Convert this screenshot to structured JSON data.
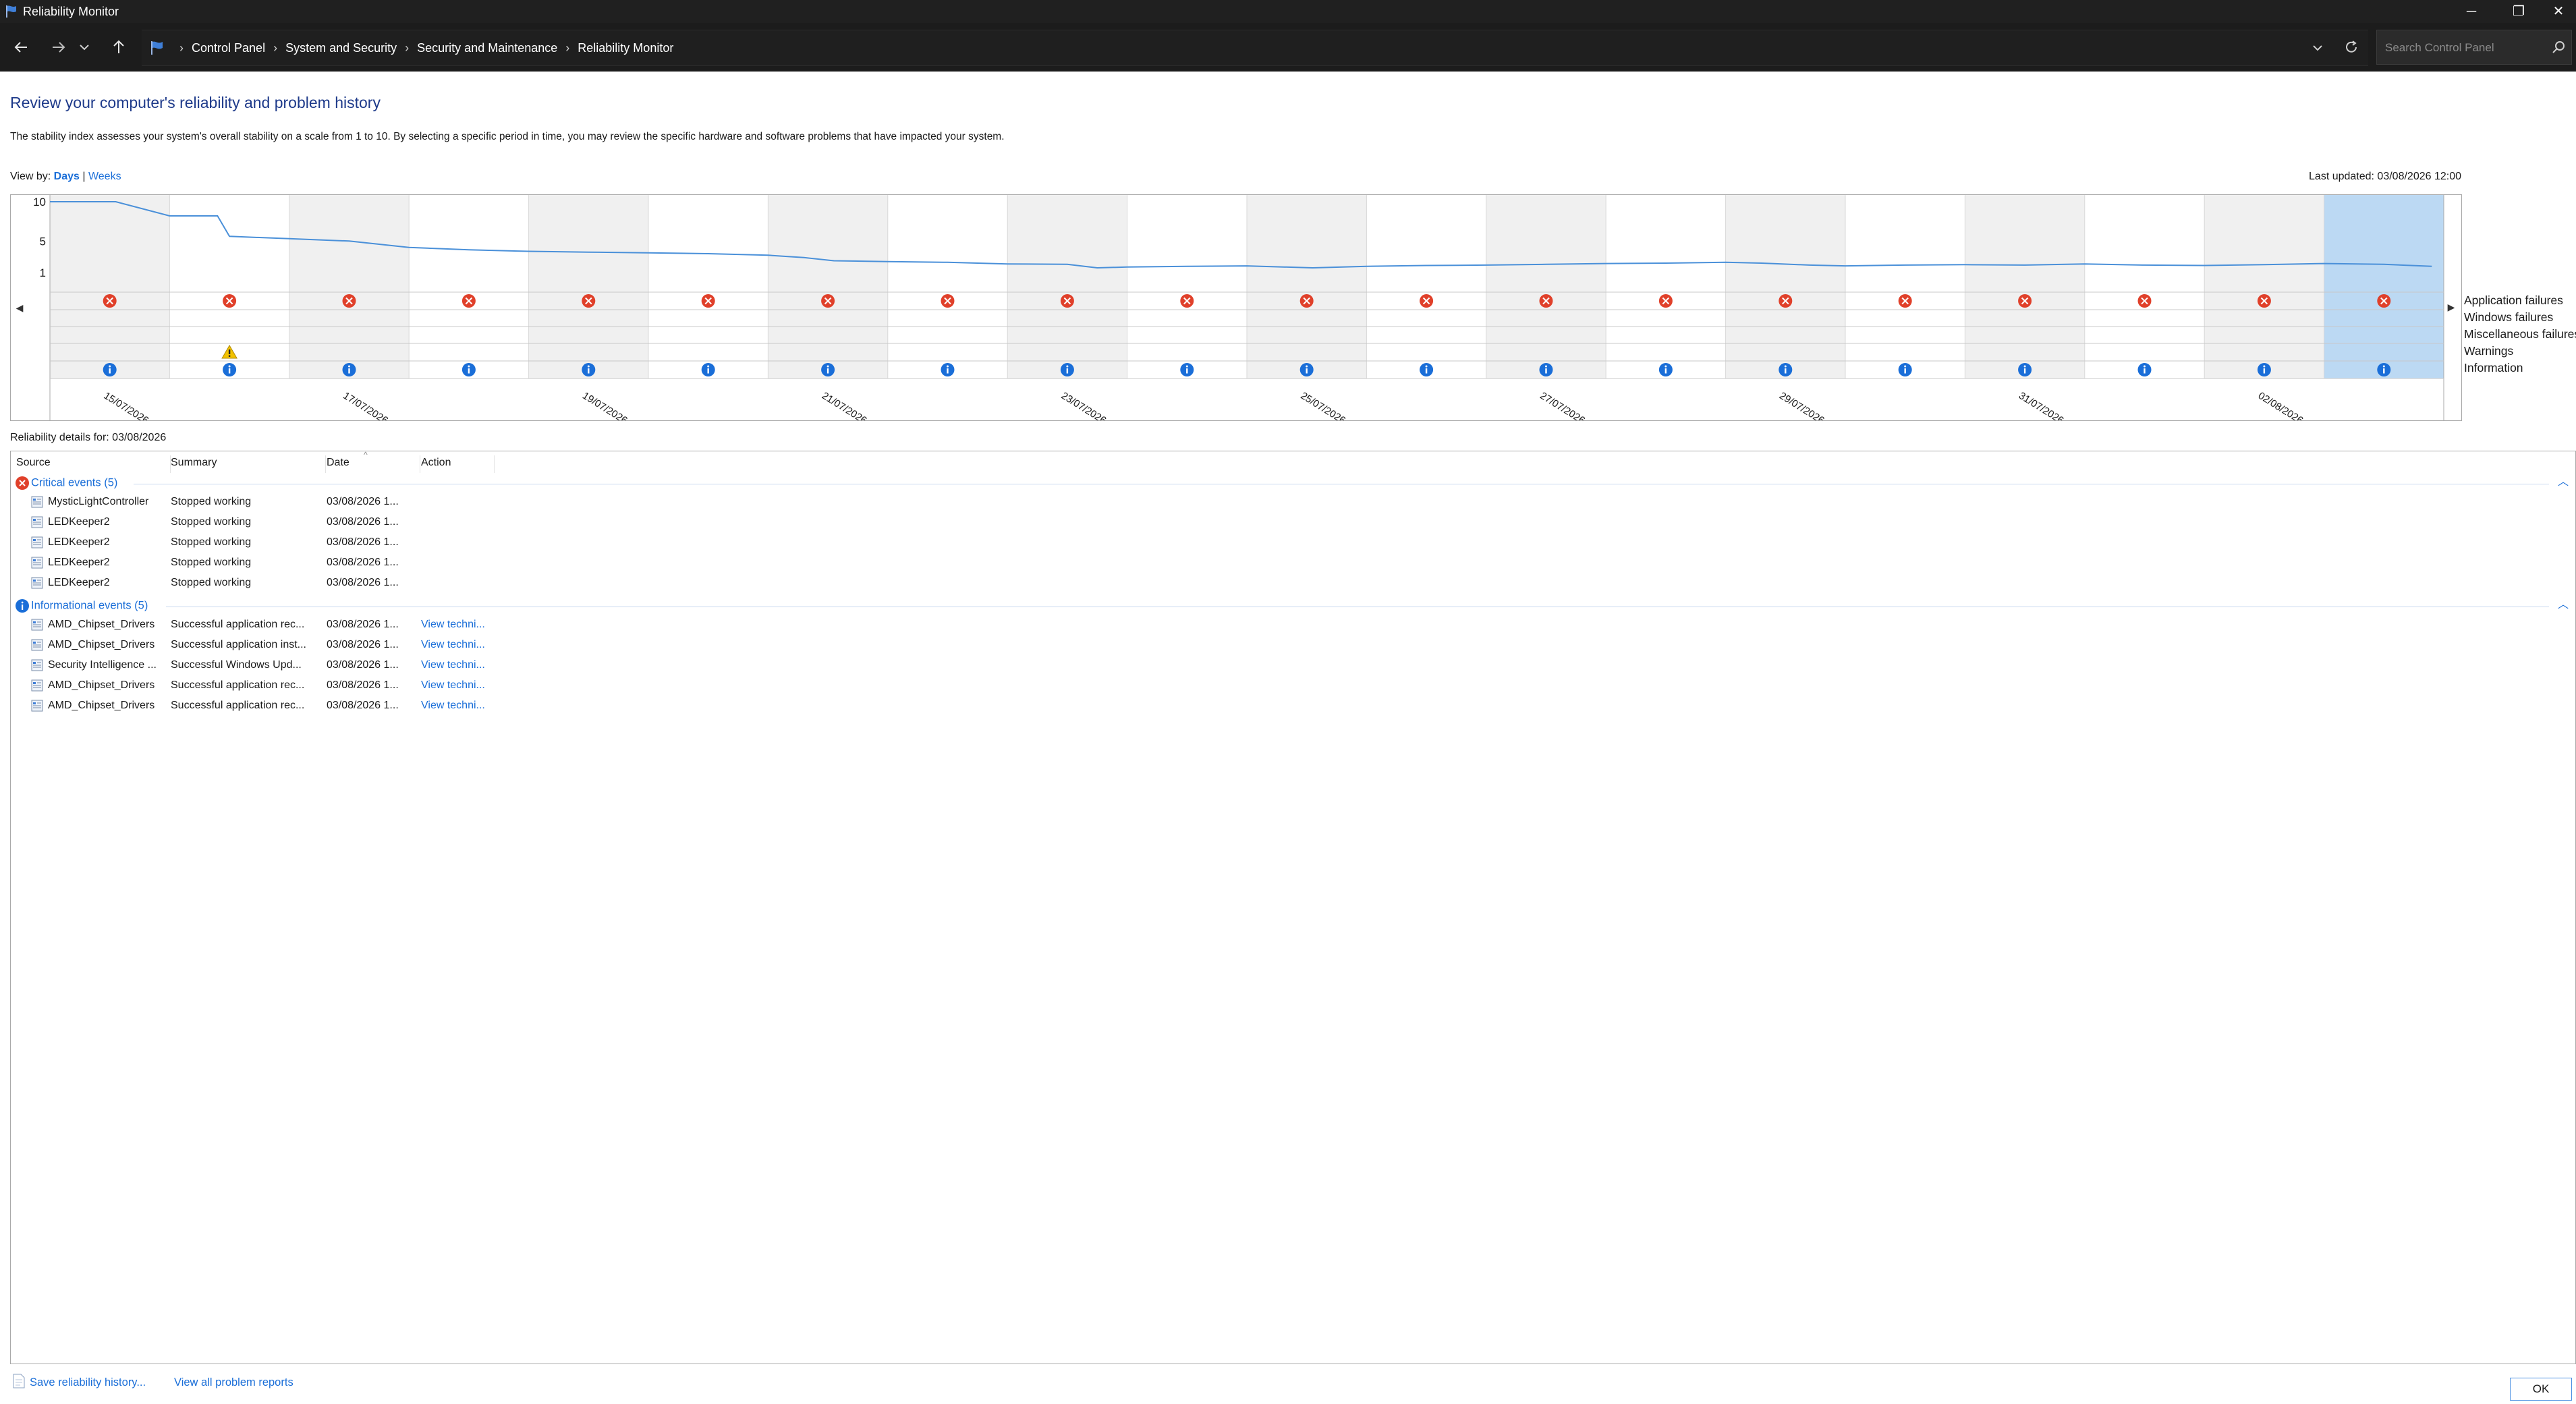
{
  "window": {
    "title": "Reliability Monitor",
    "controls": {
      "minimize": "─",
      "restore": "❐",
      "close": "✕"
    }
  },
  "address": {
    "breadcrumbs": [
      "Control Panel",
      "System and Security",
      "Security and Maintenance",
      "Reliability Monitor"
    ],
    "separator": "›",
    "search_placeholder": "Search Control Panel"
  },
  "page": {
    "title": "Review your computer's reliability and problem history",
    "description": "The stability index assesses your system's overall stability on a scale from 1 to 10. By selecting a specific period in time, you may review the specific hardware and software problems that have impacted your system.",
    "view_by_label": "View by:",
    "view_days": "Days",
    "view_sep": "|",
    "view_weeks": "Weeks",
    "last_updated": "Last updated: 03/08/2026 12:00"
  },
  "chart_data": {
    "type": "line",
    "y_tick_labels": [
      "10",
      "5",
      "1"
    ],
    "ylim": [
      1,
      10
    ],
    "date_labels": [
      "15/07/2026",
      "17/07/2026",
      "19/07/2026",
      "21/07/2026",
      "23/07/2026",
      "25/07/2026",
      "27/07/2026",
      "29/07/2026",
      "31/07/2026",
      "02/08/2026"
    ],
    "days": 20,
    "selected_day_index": 19,
    "row_labels": [
      "Application failures",
      "Windows failures",
      "Miscellaneous failures",
      "Warnings",
      "Information"
    ],
    "stability_points": [
      [
        0,
        10
      ],
      [
        0.55,
        10
      ],
      [
        1.0,
        8.2
      ],
      [
        1.4,
        8.2
      ],
      [
        1.5,
        5.6
      ],
      [
        2.0,
        5.3
      ],
      [
        2.5,
        5.0
      ],
      [
        2.75,
        4.6
      ],
      [
        3.0,
        4.2
      ],
      [
        3.5,
        3.9
      ],
      [
        4.0,
        3.7
      ],
      [
        4.5,
        3.6
      ],
      [
        5.0,
        3.5
      ],
      [
        5.5,
        3.4
      ],
      [
        6.0,
        3.2
      ],
      [
        6.3,
        2.9
      ],
      [
        6.55,
        2.5
      ],
      [
        7.0,
        2.4
      ],
      [
        7.5,
        2.3
      ],
      [
        8.0,
        2.1
      ],
      [
        8.5,
        2.05
      ],
      [
        8.75,
        1.6
      ],
      [
        9.0,
        1.7
      ],
      [
        9.5,
        1.8
      ],
      [
        10.0,
        1.85
      ],
      [
        10.55,
        1.6
      ],
      [
        11.0,
        1.8
      ],
      [
        11.5,
        1.9
      ],
      [
        12.0,
        1.95
      ],
      [
        12.5,
        2.05
      ],
      [
        13.0,
        2.15
      ],
      [
        13.5,
        2.2
      ],
      [
        14.0,
        2.3
      ],
      [
        14.3,
        2.2
      ],
      [
        14.7,
        1.95
      ],
      [
        15.0,
        1.85
      ],
      [
        15.5,
        1.95
      ],
      [
        16.0,
        2.0
      ],
      [
        16.5,
        1.95
      ],
      [
        17.0,
        2.1
      ],
      [
        17.5,
        1.95
      ],
      [
        18.0,
        1.9
      ],
      [
        18.5,
        2.0
      ],
      [
        19.0,
        2.15
      ],
      [
        19.5,
        2.05
      ],
      [
        19.9,
        1.8
      ]
    ],
    "app_failure_days": [
      0,
      1,
      2,
      3,
      4,
      5,
      6,
      7,
      8,
      9,
      10,
      11,
      12,
      13,
      14,
      15,
      16,
      17,
      18,
      19
    ],
    "warning_days": [
      1
    ],
    "information_days": [
      0,
      1,
      2,
      3,
      4,
      5,
      6,
      7,
      8,
      9,
      10,
      11,
      12,
      13,
      14,
      15,
      16,
      17,
      18,
      19
    ],
    "colors": {
      "line": "#4a90d9",
      "shade": "#f0f0f0",
      "selected": "#bcd9f3",
      "error": "#e0402a",
      "info": "#1a6ed8",
      "warning": "#f2c200"
    }
  },
  "details": {
    "label": "Reliability details for: 03/08/2026",
    "columns": [
      "Source",
      "Summary",
      "Date",
      "Action"
    ],
    "groups": [
      {
        "title": "Critical events (5)",
        "type": "error",
        "rows": [
          {
            "source": "MysticLightController",
            "summary": "Stopped working",
            "date": "03/08/2026 1...",
            "action": ""
          },
          {
            "source": "LEDKeeper2",
            "summary": "Stopped working",
            "date": "03/08/2026 1...",
            "action": ""
          },
          {
            "source": "LEDKeeper2",
            "summary": "Stopped working",
            "date": "03/08/2026 1...",
            "action": ""
          },
          {
            "source": "LEDKeeper2",
            "summary": "Stopped working",
            "date": "03/08/2026 1...",
            "action": ""
          },
          {
            "source": "LEDKeeper2",
            "summary": "Stopped working",
            "date": "03/08/2026 1...",
            "action": ""
          }
        ]
      },
      {
        "title": "Informational events (5)",
        "type": "info",
        "rows": [
          {
            "source": "AMD_Chipset_Drivers",
            "summary": "Successful application rec...",
            "date": "03/08/2026 1...",
            "action": "View techni..."
          },
          {
            "source": "AMD_Chipset_Drivers",
            "summary": "Successful application inst...",
            "date": "03/08/2026 1...",
            "action": "View techni..."
          },
          {
            "source": "Security Intelligence ...",
            "summary": "Successful Windows Upd...",
            "date": "03/08/2026 1...",
            "action": "View techni..."
          },
          {
            "source": "AMD_Chipset_Drivers",
            "summary": "Successful application rec...",
            "date": "03/08/2026 1...",
            "action": "View techni..."
          },
          {
            "source": "AMD_Chipset_Drivers",
            "summary": "Successful application rec...",
            "date": "03/08/2026 1...",
            "action": "View techni..."
          }
        ]
      }
    ]
  },
  "footer": {
    "save_history": "Save reliability history...",
    "view_all_reports": "View all problem reports",
    "ok": "OK"
  }
}
